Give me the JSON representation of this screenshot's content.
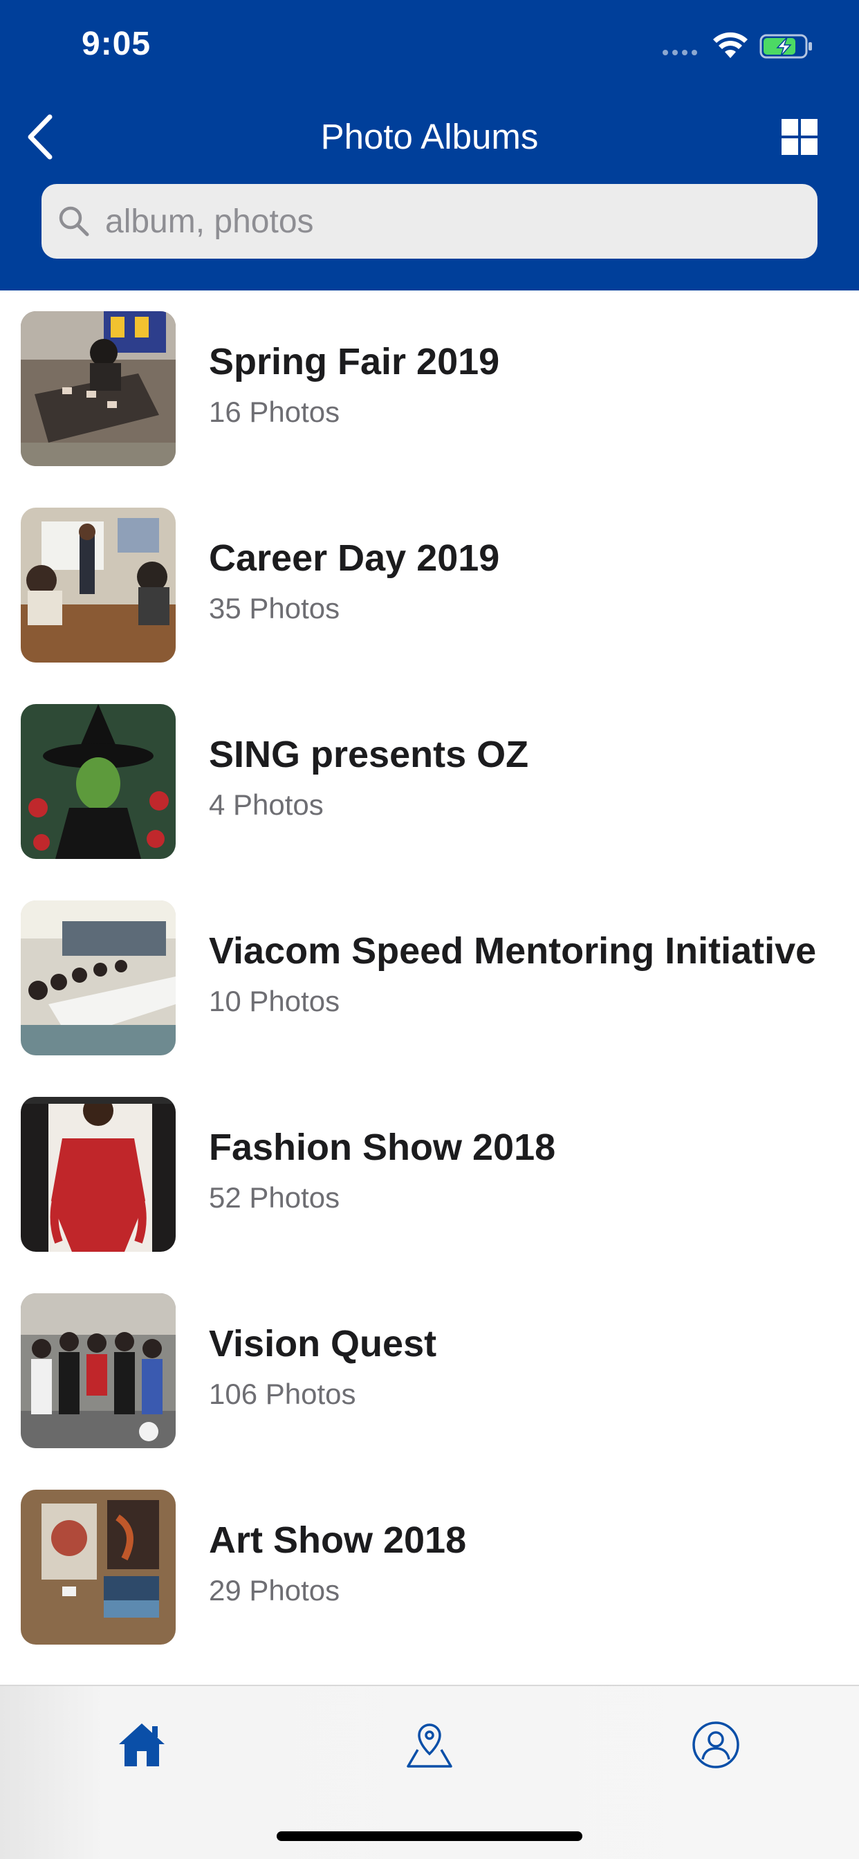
{
  "status_bar": {
    "time": "9:05"
  },
  "nav": {
    "title": "Photo Albums",
    "back_icon": "chevron-left-icon",
    "grid_icon": "grid-view-icon"
  },
  "search": {
    "placeholder": "album, photos",
    "value": ""
  },
  "albums": [
    {
      "title": "Spring Fair 2019",
      "count": "16 Photos"
    },
    {
      "title": "Career Day 2019",
      "count": "35 Photos"
    },
    {
      "title": "SING presents OZ",
      "count": "4 Photos"
    },
    {
      "title": "Viacom Speed Mentoring Initiative",
      "count": "10 Photos"
    },
    {
      "title": "Fashion Show 2018",
      "count": "52 Photos"
    },
    {
      "title": "Vision Quest",
      "count": "106 Photos"
    },
    {
      "title": "Art Show 2018",
      "count": "29 Photos"
    }
  ],
  "tab_bar": {
    "tabs": [
      {
        "icon": "home-icon",
        "active": true
      },
      {
        "icon": "map-pin-icon",
        "active": false
      },
      {
        "icon": "profile-icon",
        "active": false
      }
    ]
  },
  "colors": {
    "header": "#003f9a",
    "accent": "#0a4fa8",
    "title_text": "#1c1c1e",
    "subtitle_text": "#6e6e73"
  }
}
